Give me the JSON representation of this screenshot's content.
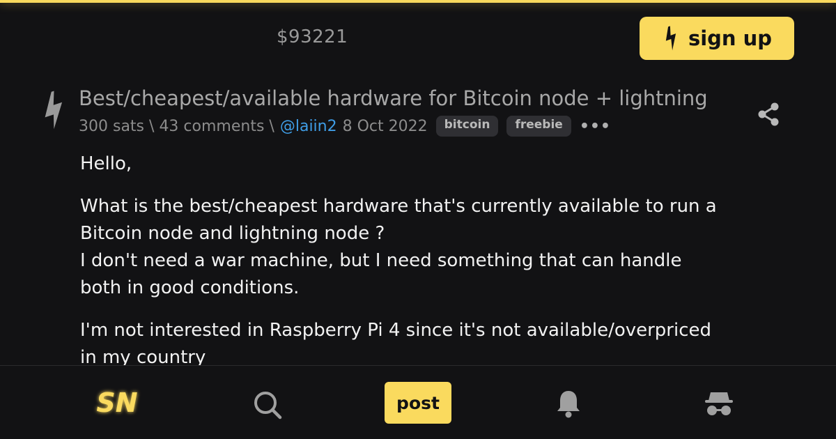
{
  "header": {
    "price": "$93221",
    "signup_label": "sign up"
  },
  "post": {
    "title": "Best/cheapest/available hardware for Bitcoin node + lightning",
    "sats": "300 sats",
    "separator1": "\\",
    "comments": "43 comments",
    "separator2": "\\",
    "author": "@laiin2",
    "date": "8 Oct 2022",
    "tags": [
      "bitcoin",
      "freebie"
    ],
    "more": "•••",
    "body": {
      "p1": "Hello,",
      "p2_line1": "What is the best/cheapest hardware that's currently available to run a",
      "p2_line2": "Bitcoin node and lightning node ?",
      "p2_line3": "I don't need a war machine, but I need something that can handle",
      "p2_line4": "both in good conditions.",
      "p3_line1": "I'm not interested in Raspberry Pi 4 since it's not available/overpriced",
      "p3_line2": "in my country"
    }
  },
  "nav": {
    "logo": "SN",
    "post_label": "post",
    "icons": [
      "lightning-icon",
      "search-icon",
      "bell-icon",
      "incognito-icon",
      "share-icon"
    ]
  },
  "colors": {
    "accent": "#fada5e",
    "background": "#121214",
    "link": "#3f9de6"
  }
}
